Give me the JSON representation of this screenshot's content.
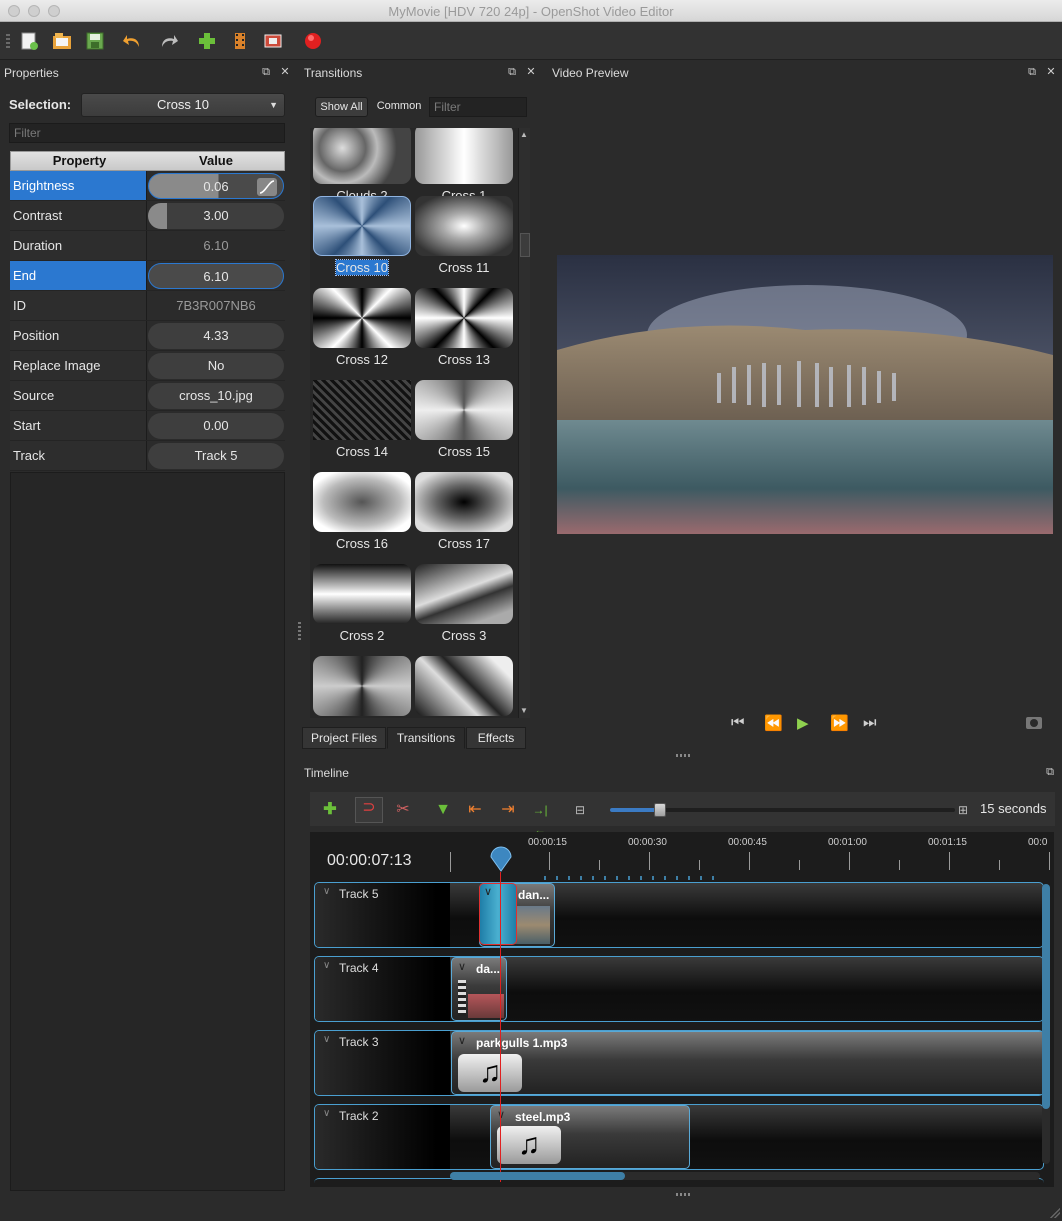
{
  "window": {
    "title": "MyMovie [HDV 720 24p] - OpenShot Video Editor"
  },
  "properties": {
    "title": "Properties",
    "selection_label": "Selection:",
    "selection_value": "Cross 10",
    "filter_placeholder": "Filter",
    "headers": [
      "Property",
      "Value"
    ],
    "rows": [
      {
        "name": "Brightness",
        "value": "0.06",
        "selected": true,
        "fill": 0.06
      },
      {
        "name": "Contrast",
        "value": "3.00",
        "fill": 0.1
      },
      {
        "name": "Duration",
        "value": "6.10",
        "readonly": true
      },
      {
        "name": "End",
        "value": "6.10",
        "selected": true
      },
      {
        "name": "ID",
        "value": "7B3R007NB6",
        "readonly": true
      },
      {
        "name": "Position",
        "value": "4.33"
      },
      {
        "name": "Replace Image",
        "value": "No"
      },
      {
        "name": "Source",
        "value": "cross_10.jpg"
      },
      {
        "name": "Start",
        "value": "0.00"
      },
      {
        "name": "Track",
        "value": "Track 5"
      }
    ]
  },
  "transitions": {
    "title": "Transitions",
    "show_all": "Show All",
    "common": "Common",
    "filter_placeholder": "Filter",
    "items": [
      "Clouds 2",
      "Cross 1",
      "Cross 10",
      "Cross 11",
      "Cross 12",
      "Cross 13",
      "Cross 14",
      "Cross 15",
      "Cross 16",
      "Cross 17",
      "Cross 2",
      "Cross 3"
    ],
    "selected": "Cross 10",
    "tabs": [
      "Project Files",
      "Transitions",
      "Effects"
    ],
    "active_tab": "Transitions"
  },
  "preview": {
    "title": "Video Preview"
  },
  "timeline": {
    "title": "Timeline",
    "zoom_label": "15 seconds",
    "current_time": "00:00:07:13",
    "ruler": [
      "00:00:15",
      "00:00:30",
      "00:00:45",
      "00:01:00",
      "00:01:15",
      "00:0"
    ],
    "tracks": [
      {
        "name": "Track 5",
        "clips": [
          {
            "name": "dan..."
          }
        ]
      },
      {
        "name": "Track 4",
        "clips": [
          {
            "name": "da..."
          }
        ]
      },
      {
        "name": "Track 3",
        "clips": [
          {
            "name": "parkgulls 1.mp3"
          }
        ]
      },
      {
        "name": "Track 2",
        "clips": [
          {
            "name": "steel.mp3"
          }
        ]
      }
    ]
  },
  "colors": {
    "accent": "#2b78d0",
    "track_border": "#4a9fd0",
    "record": "#e02020"
  }
}
